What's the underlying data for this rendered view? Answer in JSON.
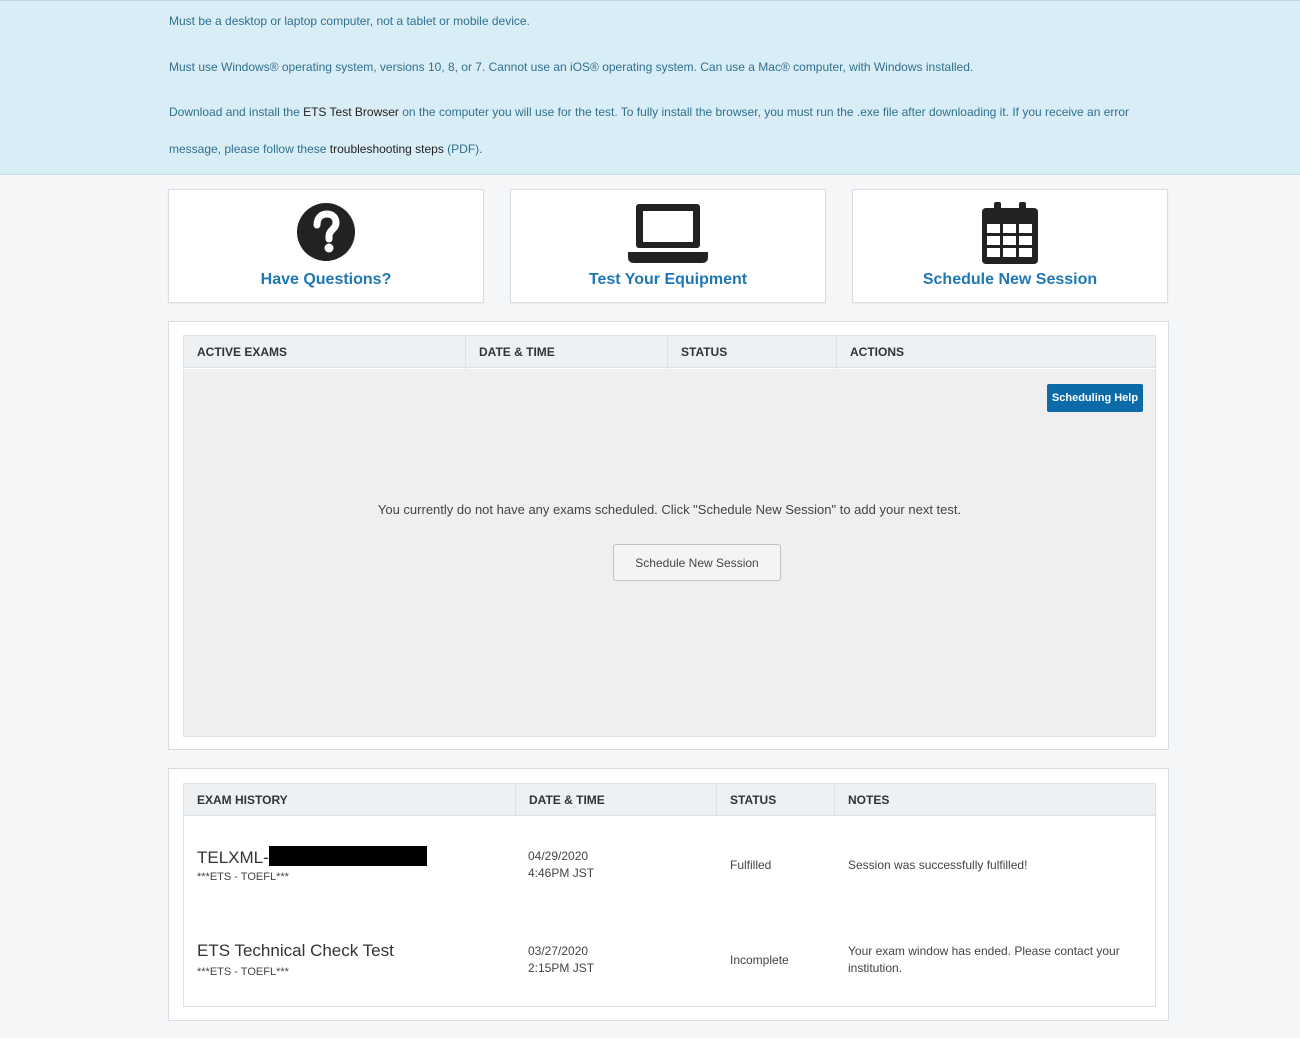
{
  "notice": {
    "line1": "Must be a desktop or laptop computer, not a tablet or mobile device.",
    "line2": "Must use Windows® operating system, versions 10, 8, or 7. Cannot use an iOS® operating system. Can use a Mac® computer, with Windows installed.",
    "line3_before": "Download and install the ",
    "line3_link": "ETS Test Browser",
    "line3_after": " on the computer you will use for the test. To fully install the browser, you must run the .exe file after downloading it. If you receive an error",
    "line4_before": "message, please follow these ",
    "line4_link": "troubleshooting steps",
    "line4_after": " (PDF)."
  },
  "tiles": [
    {
      "label": "Have Questions?",
      "icon": "question-circle-icon"
    },
    {
      "label": "Test Your Equipment",
      "icon": "laptop-icon"
    },
    {
      "label": "Schedule New Session",
      "icon": "calendar-icon"
    }
  ],
  "active": {
    "headers": [
      "ACTIVE EXAMS",
      "DATE & TIME",
      "STATUS",
      "ACTIONS"
    ],
    "help_button": "Scheduling Help",
    "empty_message": "You currently do not have any exams scheduled. Click \"Schedule New Session\" to add your next test.",
    "schedule_button": "Schedule New Session"
  },
  "history": {
    "headers": [
      "EXAM HISTORY",
      "DATE & TIME",
      "STATUS",
      "NOTES"
    ],
    "rows": [
      {
        "name": "TELXML-",
        "sub": "***ETS - TOEFL***",
        "date": "04/29/2020",
        "time": "4:46PM JST",
        "status": "Fulfilled",
        "notes1": "Session was successfully fulfilled!",
        "notes2": ""
      },
      {
        "name": "ETS Technical Check Test",
        "sub": "***ETS - TOEFL***",
        "date": "03/27/2020",
        "time": "2:15PM JST",
        "status": "Incomplete",
        "notes1": "Your exam window has ended. Please contact your",
        "notes2": "institution."
      }
    ]
  },
  "colors": {
    "accent": "#1f77b4",
    "button": "#0b6aa8",
    "notice_bg": "#d9edf6"
  }
}
